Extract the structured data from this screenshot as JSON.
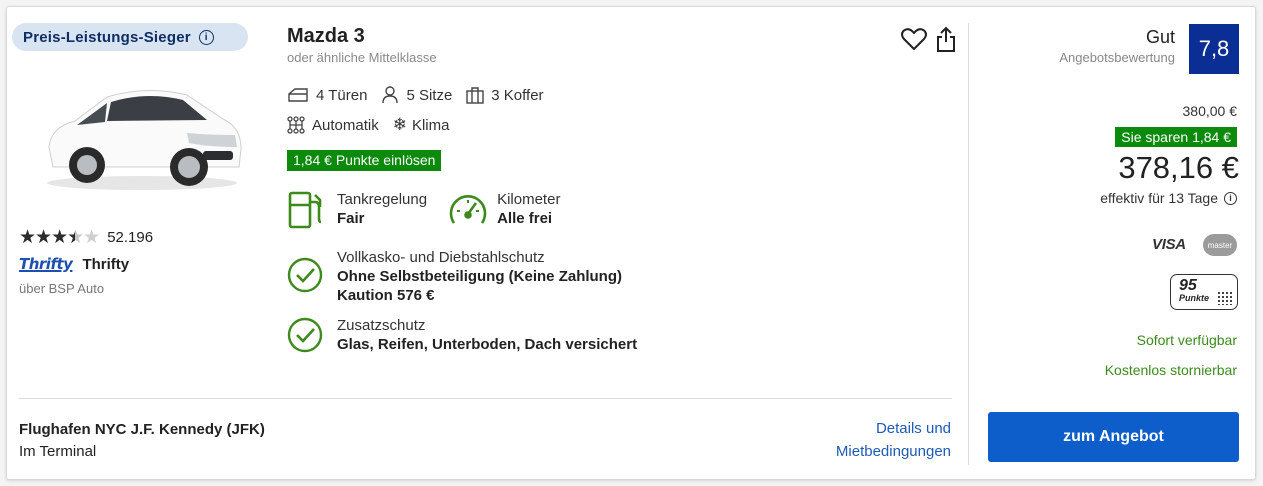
{
  "badge": {
    "label": "Preis-Leistungs-Sieger",
    "info": "i"
  },
  "supplier": {
    "rating_value": 3.5,
    "review_count": "52.196",
    "logo_text": "Thrifty",
    "name": "Thrifty",
    "via": "über BSP Auto"
  },
  "car": {
    "title": "Mazda 3",
    "subtitle": "oder ähnliche Mittelklasse",
    "features_row1": [
      "4 Türen",
      "5 Sitze",
      "3 Koffer"
    ],
    "features_row2": [
      "Automatik",
      "Klima"
    ],
    "points_tag": "1,84 € Punkte einlösen"
  },
  "fuel": {
    "label": "Tankregelung",
    "value": "Fair"
  },
  "mileage": {
    "label": "Kilometer",
    "value": "Alle frei"
  },
  "insurance1": {
    "label": "Vollkasko- und Diebstahlschutz",
    "value1": "Ohne Selbstbeteiligung (Keine Zahlung)",
    "value2": "Kaution 576 €"
  },
  "insurance2": {
    "label": "Zusatzschutz",
    "value": "Glas, Reifen, Unterboden, Dach versichert"
  },
  "location": {
    "name": "Flughafen NYC J.F. Kennedy (JFK)",
    "detail": "Im Terminal"
  },
  "links": {
    "details_line1": "Details und",
    "details_line2": "Mietbedingungen"
  },
  "offer": {
    "score_label": "Gut",
    "score_sub": "Angebotsbewertung",
    "score": "7,8",
    "old_price": "380,00 €",
    "savings": "Sie sparen 1,84 €",
    "price": "378,16 €",
    "effective": "effektiv für 13 Tage",
    "payment1": "VISA",
    "payment2": "master",
    "points_number": "95",
    "points_word": "Punkte",
    "availability": "Sofort verfügbar",
    "cancellation": "Kostenlos stornierbar",
    "cta": "zum Angebot"
  },
  "colors": {
    "accent": "#0d5ecb",
    "green": "#0c8a0c",
    "score_bg": "#0b2e94"
  }
}
